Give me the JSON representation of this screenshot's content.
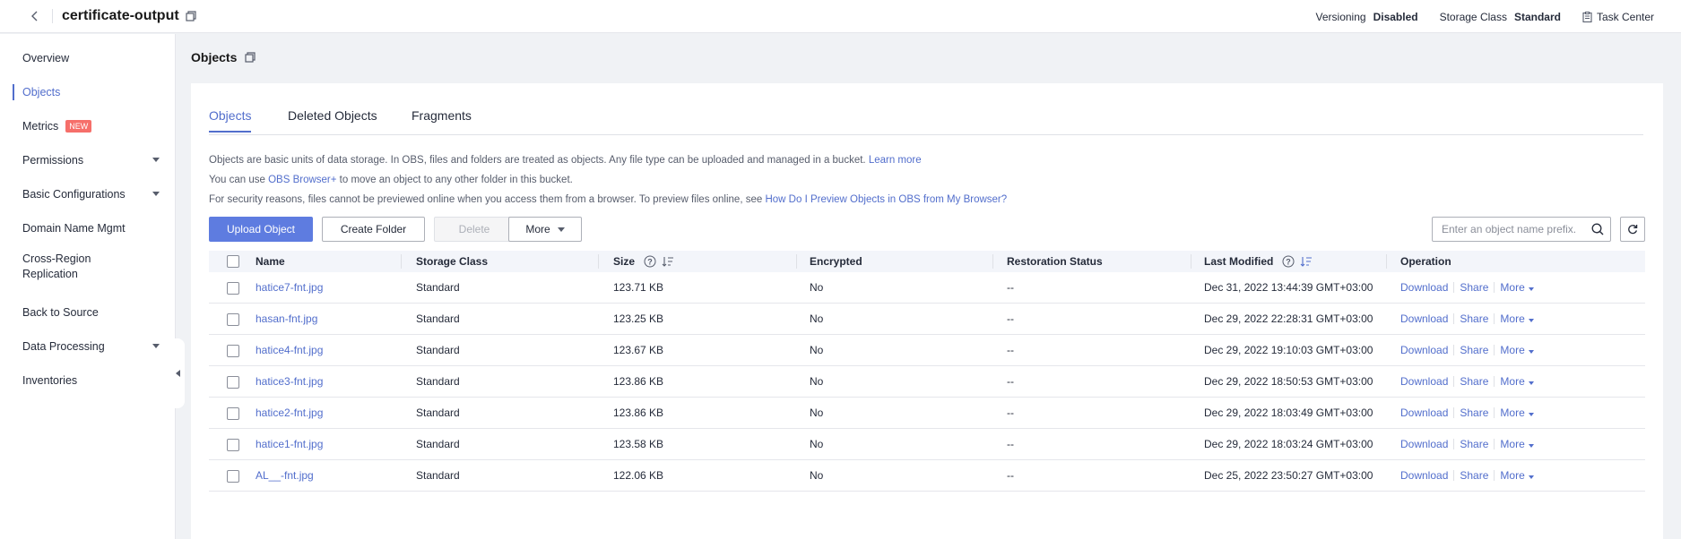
{
  "header": {
    "bucket_name": "certificate-output",
    "versioning_label": "Versioning",
    "versioning_value": "Disabled",
    "storage_class_label": "Storage Class",
    "storage_class_value": "Standard",
    "task_center": "Task Center"
  },
  "sidebar": {
    "items": [
      {
        "label": "Overview"
      },
      {
        "label": "Objects"
      },
      {
        "label": "Metrics",
        "badge": "NEW"
      },
      {
        "label": "Permissions"
      },
      {
        "label": "Basic Configurations"
      },
      {
        "label": "Domain Name Mgmt"
      },
      {
        "label": "Cross-Region Replication"
      },
      {
        "label": "Back to Source"
      },
      {
        "label": "Data Processing"
      },
      {
        "label": "Inventories"
      }
    ]
  },
  "page": {
    "title": "Objects",
    "tabs": [
      "Objects",
      "Deleted Objects",
      "Fragments"
    ],
    "desc1_text": "Objects are basic units of data storage. In OBS, files and folders are treated as objects. Any file type can be uploaded and managed in a bucket.",
    "desc1_link": "Learn more",
    "desc2_pre": "You can use",
    "desc2_link": "OBS Browser+",
    "desc2_post": "to move an object to any other folder in this bucket.",
    "desc3_text": "For security reasons, files cannot be previewed online when you access them from a browser. To preview files online, see",
    "desc3_link": "How Do I Preview Objects in OBS from My Browser?",
    "buttons": {
      "upload": "Upload Object",
      "create_folder": "Create Folder",
      "delete": "Delete",
      "more": "More"
    },
    "search_placeholder": "Enter an object name prefix."
  },
  "table": {
    "columns": {
      "name": "Name",
      "storage_class": "Storage Class",
      "size": "Size",
      "encrypted": "Encrypted",
      "restoration": "Restoration Status",
      "last_modified": "Last Modified",
      "operation": "Operation"
    },
    "op_labels": {
      "download": "Download",
      "share": "Share",
      "more": "More"
    },
    "rows": [
      {
        "name": "hatice7-fnt.jpg",
        "storage_class": "Standard",
        "size": "123.71 KB",
        "encrypted": "No",
        "restoration": "--",
        "last_modified": "Dec 31, 2022 13:44:39 GMT+03:00"
      },
      {
        "name": "hasan-fnt.jpg",
        "storage_class": "Standard",
        "size": "123.25 KB",
        "encrypted": "No",
        "restoration": "--",
        "last_modified": "Dec 29, 2022 22:28:31 GMT+03:00"
      },
      {
        "name": "hatice4-fnt.jpg",
        "storage_class": "Standard",
        "size": "123.67 KB",
        "encrypted": "No",
        "restoration": "--",
        "last_modified": "Dec 29, 2022 19:10:03 GMT+03:00"
      },
      {
        "name": "hatice3-fnt.jpg",
        "storage_class": "Standard",
        "size": "123.86 KB",
        "encrypted": "No",
        "restoration": "--",
        "last_modified": "Dec 29, 2022 18:50:53 GMT+03:00"
      },
      {
        "name": "hatice2-fnt.jpg",
        "storage_class": "Standard",
        "size": "123.86 KB",
        "encrypted": "No",
        "restoration": "--",
        "last_modified": "Dec 29, 2022 18:03:49 GMT+03:00"
      },
      {
        "name": "hatice1-fnt.jpg",
        "storage_class": "Standard",
        "size": "123.58 KB",
        "encrypted": "No",
        "restoration": "--",
        "last_modified": "Dec 29, 2022 18:03:24 GMT+03:00"
      },
      {
        "name": "AL__-fnt.jpg",
        "storage_class": "Standard",
        "size": "122.06 KB",
        "encrypted": "No",
        "restoration": "--",
        "last_modified": "Dec 25, 2022 23:50:27 GMT+03:00"
      }
    ]
  },
  "colors": {
    "accent": "#526ecc",
    "primary_button": "#5e7ce0",
    "new_badge": "#f66f6a"
  }
}
